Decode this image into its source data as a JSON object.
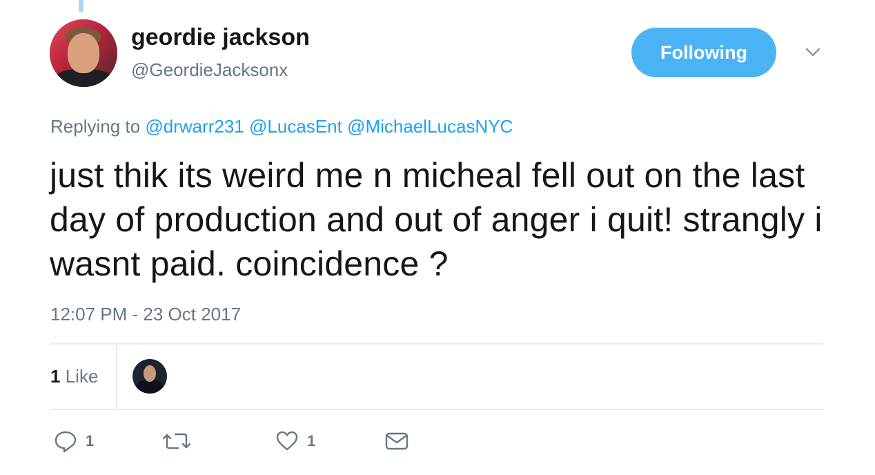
{
  "tweet": {
    "author": {
      "display_name": "geordie jackson",
      "handle": "@GeordieJacksonx"
    },
    "follow_button_label": "Following",
    "replying_label": "Replying to",
    "mentions": [
      "@drwarr231",
      "@LucasEnt",
      "@MichaelLucasNYC"
    ],
    "text": "just thik its weird me n micheal fell out on the last day of production and out of anger i quit! strangly i wasnt paid. coincidence ?",
    "timestamp": "12:07 PM - 23 Oct 2017",
    "stats": {
      "likes_number": "1",
      "likes_label": "Like"
    },
    "actions": {
      "reply_count": "1",
      "retweet_count": "",
      "like_count": "1"
    }
  },
  "colors": {
    "accent": "#1da1f2",
    "button": "#4ab3f4",
    "muted_text": "#657786",
    "divider": "#e6ecf0"
  },
  "icons": [
    "reply-icon",
    "retweet-icon",
    "heart-icon",
    "envelope-icon",
    "chevron-down-icon"
  ]
}
